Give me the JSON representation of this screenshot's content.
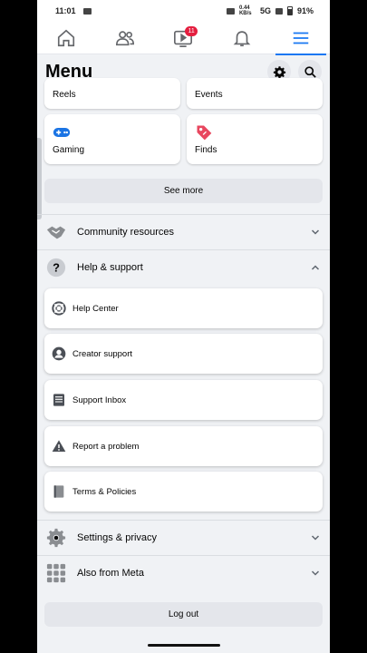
{
  "status_bar": {
    "time": "11:01",
    "net_speed": "0.44 KB/s",
    "network": "5G",
    "battery": "91%"
  },
  "top_nav": {
    "items": [
      {
        "icon": "home-icon"
      },
      {
        "icon": "friends-icon"
      },
      {
        "icon": "video-icon",
        "badge": "11"
      },
      {
        "icon": "bell-icon"
      },
      {
        "icon": "menu-icon",
        "active": true
      }
    ],
    "accent": "#1877f2",
    "badge_color": "#e41e3f"
  },
  "header": {
    "title": "Menu",
    "settings_icon": "gear-icon",
    "search_icon": "search-icon"
  },
  "shortcuts": [
    {
      "label": "Reels",
      "icon": "reels-icon"
    },
    {
      "label": "Events",
      "icon": "events-icon"
    },
    {
      "label": "Gaming",
      "icon": "gamepad-icon"
    },
    {
      "label": "Finds",
      "icon": "tag-icon"
    }
  ],
  "see_more": "See more",
  "sections": {
    "community": {
      "label": "Community resources",
      "icon": "handshake-icon",
      "expanded": false
    },
    "help": {
      "label": "Help & support",
      "icon": "question-icon",
      "expanded": true,
      "items": [
        {
          "label": "Help Center",
          "icon": "lifebuoy-icon"
        },
        {
          "label": "Creator support",
          "icon": "creator-icon"
        },
        {
          "label": "Support Inbox",
          "icon": "inbox-icon"
        },
        {
          "label": "Report a problem",
          "icon": "warning-icon"
        },
        {
          "label": "Terms & Policies",
          "icon": "book-icon"
        }
      ]
    },
    "settings": {
      "label": "Settings & privacy",
      "icon": "gear-icon",
      "expanded": false
    },
    "meta": {
      "label": "Also from Meta",
      "icon": "grid-icon",
      "expanded": false
    }
  },
  "logout": "Log out"
}
